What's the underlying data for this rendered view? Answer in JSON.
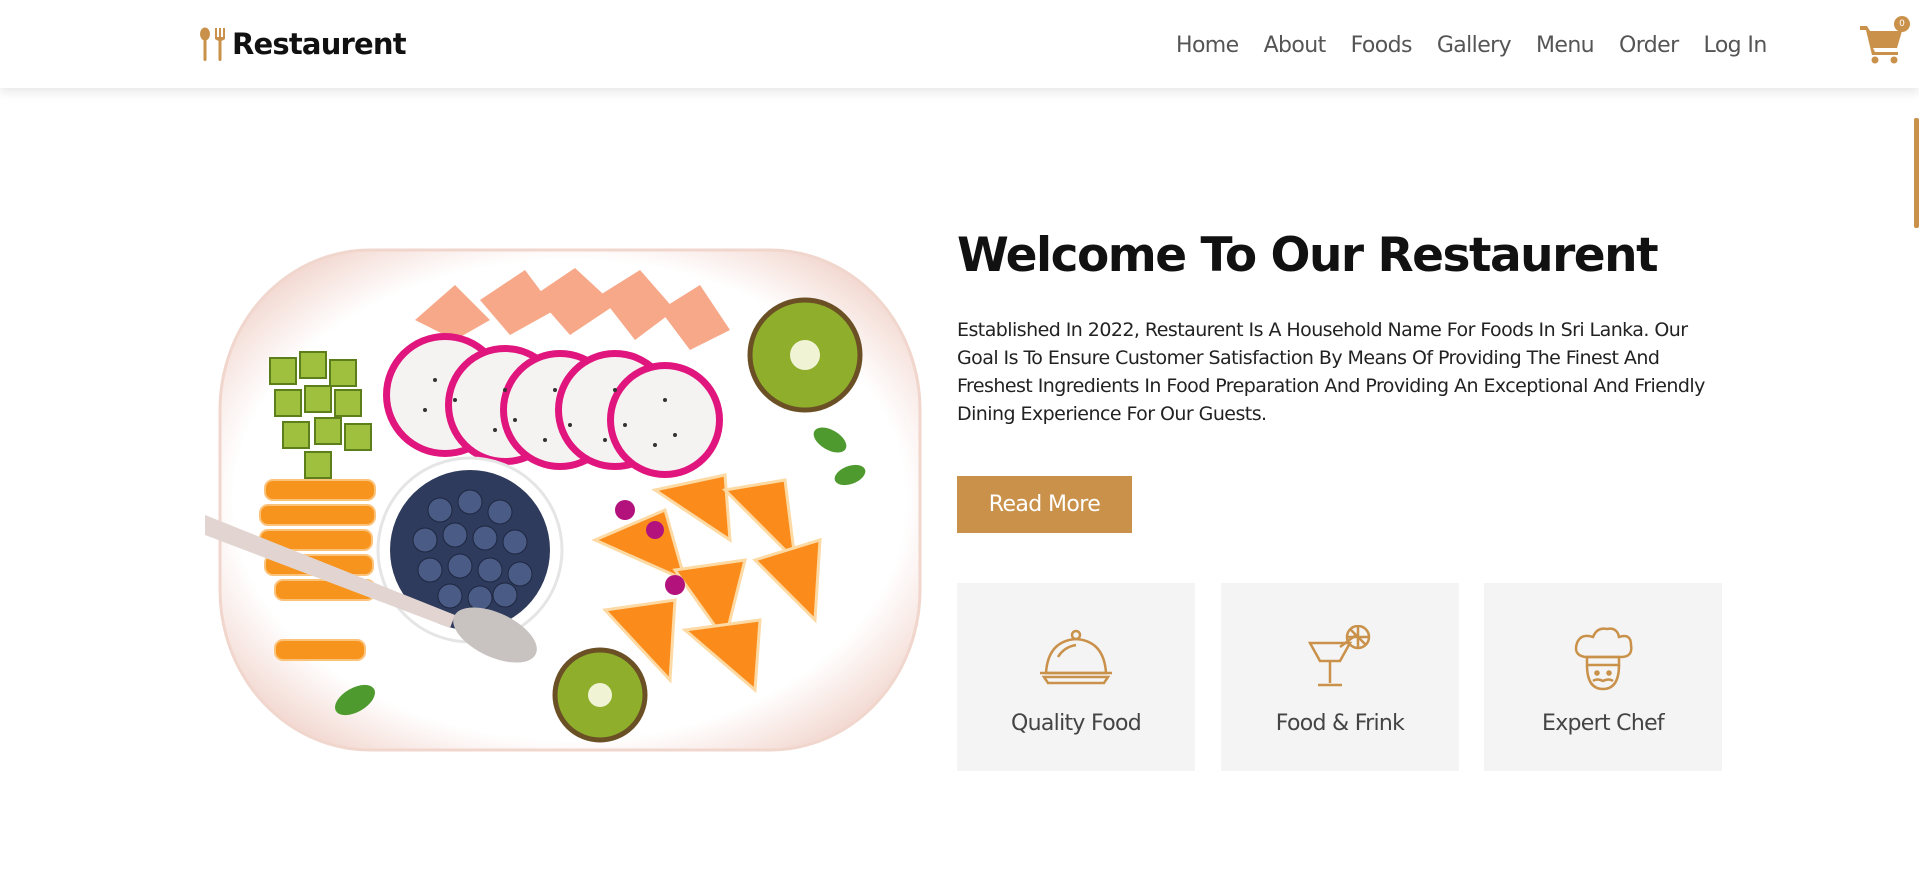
{
  "brand": {
    "name": "Restaurent",
    "accent": "#c9914a"
  },
  "nav": {
    "items": [
      {
        "label": "Home"
      },
      {
        "label": "About"
      },
      {
        "label": "Foods"
      },
      {
        "label": "Gallery"
      },
      {
        "label": "Menu"
      },
      {
        "label": "Order"
      },
      {
        "label": "Log In"
      }
    ]
  },
  "cart": {
    "icon": "shopping-cart-icon",
    "count": "0"
  },
  "hero": {
    "image": "fruit-platter-image",
    "title": "Welcome To Our Restaurent",
    "description": "Established In 2022, Restaurent Is A Household Name For Foods In Sri Lanka. Our Goal Is To Ensure Customer Satisfaction By Means Of Providing The Finest And Freshest Ingredients In Food Preparation And Providing An Exceptional And Friendly Dining Experience For Our Guests.",
    "button_label": "Read More"
  },
  "features": [
    {
      "icon": "cloche-icon",
      "label": "Quality Food"
    },
    {
      "icon": "cocktail-icon",
      "label": "Food & Frink"
    },
    {
      "icon": "chef-icon",
      "label": "Expert Chef"
    }
  ]
}
